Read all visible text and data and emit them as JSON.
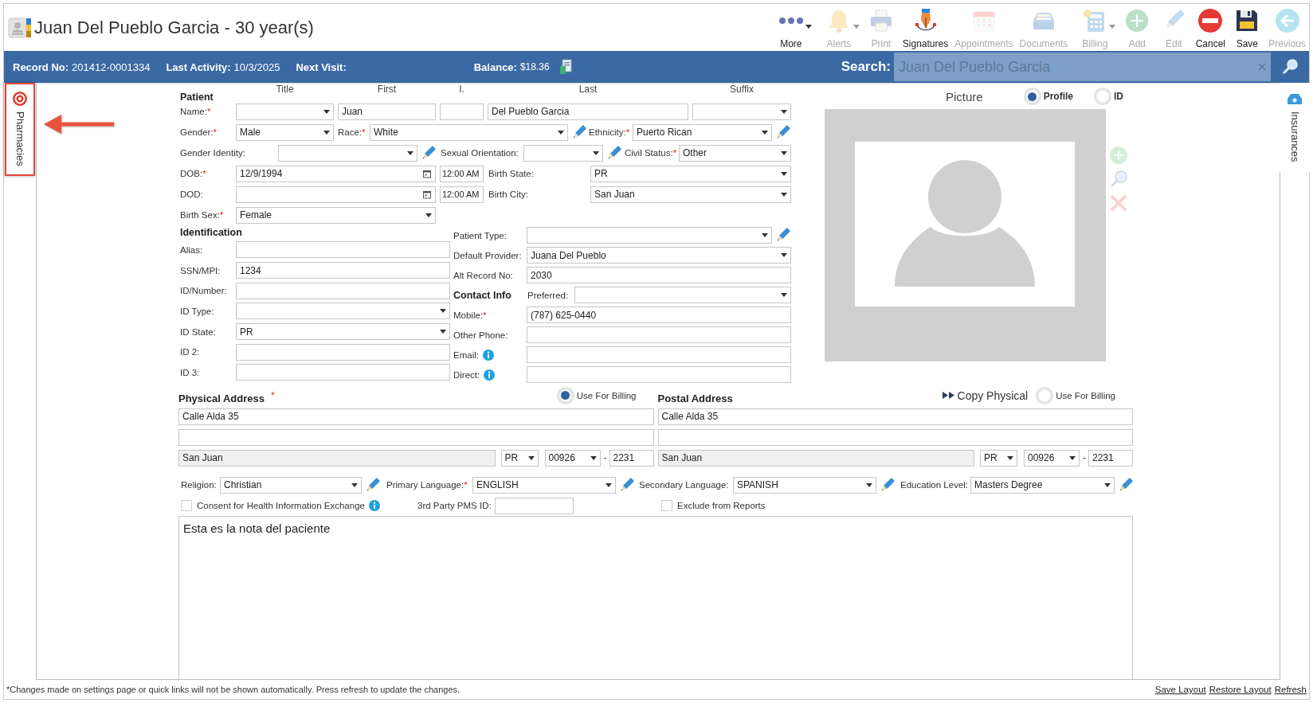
{
  "title": "Juan Del Pueblo Garcia - 30 year(s)",
  "toolbar": [
    {
      "label": "More",
      "disabled": false,
      "dropdown": true
    },
    {
      "label": "Alerts",
      "disabled": true,
      "dropdown": true
    },
    {
      "label": "Print",
      "disabled": true,
      "dropdown": false
    },
    {
      "label": "Signatures",
      "disabled": false,
      "dropdown": false
    },
    {
      "label": "Appointments",
      "disabled": true,
      "dropdown": false
    },
    {
      "label": "Documents",
      "disabled": true,
      "dropdown": false
    },
    {
      "label": "Billing",
      "disabled": true,
      "dropdown": true
    },
    {
      "label": "Add",
      "disabled": true,
      "dropdown": false
    },
    {
      "label": "Edit",
      "disabled": true,
      "dropdown": false
    },
    {
      "label": "Cancel",
      "disabled": false,
      "dropdown": false
    },
    {
      "label": "Save",
      "disabled": false,
      "dropdown": false
    },
    {
      "label": "Previous",
      "disabled": true,
      "dropdown": false
    }
  ],
  "info_bar": {
    "items": [
      {
        "label": "Record No:",
        "value": "201412-0001334"
      },
      {
        "label": "Last Activity:",
        "value": "10/3/2025"
      },
      {
        "label": "Next Visit:"
      }
    ],
    "balance": {
      "label": "Balance:",
      "value": "$18.36"
    }
  },
  "search": {
    "label": "Search:",
    "value": "Juan Del Pueblo Garcia"
  },
  "left_tabs": [
    {
      "label": "Pharmacies",
      "highlighted": true
    }
  ],
  "right_tabs": [
    {
      "label": "Insurances",
      "highlighted": false
    }
  ],
  "patient_rows": [
    [
      {
        "kind": "heading",
        "text": "Patient"
      },
      {
        "kind": "caption",
        "text": "Title"
      },
      {
        "kind": "caption",
        "text": "First"
      },
      {
        "kind": "caption",
        "text": "I."
      },
      {
        "kind": "caption",
        "text": "Last"
      },
      {
        "kind": "caption",
        "text": "Suffix"
      }
    ],
    [
      {
        "kind": "label",
        "text": "Name:",
        "mark": "*"
      },
      {
        "kind": "select"
      },
      {
        "kind": "text",
        "value": "Juan"
      },
      {
        "kind": "text"
      },
      {
        "kind": "text",
        "value": "Del Pueblo Garcia"
      },
      {
        "kind": "select"
      }
    ],
    [
      {
        "kind": "label",
        "text": "Gender:",
        "mark": "*"
      },
      {
        "kind": "select",
        "value": "Male"
      },
      {
        "kind": "label",
        "text": "Race:",
        "mark": "*"
      },
      {
        "kind": "select",
        "value": "White",
        "edit_button": true
      },
      {
        "kind": "label",
        "text": "Ethnicity:",
        "mark": "*"
      },
      {
        "kind": "select",
        "value": "Puerto Rican",
        "edit_button": true
      }
    ],
    [
      {
        "kind": "label",
        "text": "Gender Identity:"
      },
      {
        "kind": "select",
        "edit_button": true
      },
      {
        "kind": "label",
        "text": "Sexual Orientation:"
      },
      {
        "kind": "select",
        "edit_button": true
      },
      {
        "kind": "label",
        "text": "Civil Status:",
        "mark": "*"
      },
      {
        "kind": "select",
        "value": "Other"
      }
    ],
    [
      {
        "kind": "label",
        "text": "DOB:",
        "mark": "*"
      },
      {
        "kind": "date",
        "value": "12/9/1994"
      },
      {
        "kind": "time",
        "value": "12:00 AM"
      },
      {
        "kind": "label",
        "text": "Birth State:"
      },
      {
        "kind": "select",
        "value": "PR"
      }
    ],
    [
      {
        "kind": "label",
        "text": "DOD:"
      },
      {
        "kind": "date"
      },
      {
        "kind": "time",
        "value": "12:00 AM"
      },
      {
        "kind": "label",
        "text": "Birth City:"
      },
      {
        "kind": "select",
        "value": "San Juan"
      }
    ],
    [
      {
        "kind": "label",
        "text": "Birth Sex:",
        "mark": "*"
      },
      {
        "kind": "select",
        "value": "Female"
      }
    ]
  ],
  "identification": {
    "title": "Identification",
    "rows": [
      [
        {
          "kind": "label",
          "text": "Alias:"
        },
        {
          "kind": "text"
        }
      ],
      [
        {
          "kind": "label",
          "text": "SSN/MPI:"
        },
        {
          "kind": "text",
          "value": "1234"
        }
      ],
      [
        {
          "kind": "label",
          "text": "ID/Number:"
        },
        {
          "kind": "text"
        }
      ],
      [
        {
          "kind": "label",
          "text": "ID Type:"
        },
        {
          "kind": "select"
        }
      ],
      [
        {
          "kind": "label",
          "text": "ID State:"
        },
        {
          "kind": "select",
          "value": "PR"
        }
      ],
      [
        {
          "kind": "label",
          "text": "ID 2:"
        },
        {
          "kind": "text"
        }
      ],
      [
        {
          "kind": "label",
          "text": "ID 3:"
        },
        {
          "kind": "text"
        }
      ]
    ]
  },
  "contact_rows": [
    [
      {
        "kind": "label",
        "text": "Patient Type:"
      },
      {
        "kind": "select",
        "edit_button": true
      }
    ],
    [
      {
        "kind": "label",
        "text": "Default Provider:"
      },
      {
        "kind": "select",
        "value": "Juana Del Pueblo"
      }
    ],
    [
      {
        "kind": "label",
        "text": "Alt Record No:"
      },
      {
        "kind": "text",
        "value": "2030"
      }
    ],
    [
      {
        "kind": "heading",
        "text": "Contact Info"
      },
      {
        "kind": "label",
        "text": "Preferred:"
      },
      {
        "kind": "select"
      }
    ],
    [
      {
        "kind": "label",
        "text": "Mobile:",
        "mark": "*"
      },
      {
        "kind": "text",
        "value": "(787) 625-0440"
      }
    ],
    [
      {
        "kind": "label",
        "text": "Other Phone:"
      },
      {
        "kind": "text"
      }
    ],
    [
      {
        "kind": "label",
        "text": "Email:",
        "info": true
      },
      {
        "kind": "text"
      }
    ],
    [
      {
        "kind": "label",
        "text": "Direct:",
        "info": true
      },
      {
        "kind": "text"
      }
    ]
  ],
  "picture": {
    "title": "Picture",
    "modes": [
      {
        "label": "Profile",
        "selected": true
      },
      {
        "label": "ID",
        "selected": false
      }
    ]
  },
  "physical_address": {
    "title": "Physical Address",
    "mark": "*",
    "use_for_billing": {
      "label": "Use For Billing",
      "selected": true
    },
    "lines": [
      {
        "kind": "text",
        "value": "Calle Alda 35"
      },
      {
        "kind": "text"
      }
    ],
    "city": {
      "value": "San Juan",
      "readonly": true
    },
    "state": "PR",
    "zip": "00926",
    "zip_separator": "-",
    "zip_ext": "2231"
  },
  "postal_address": {
    "title": "Postal Address",
    "copy_button": "Copy Physical",
    "use_for_billing": {
      "label": "Use For Billing",
      "selected": false
    },
    "lines": [
      {
        "kind": "text",
        "value": "Calle Alda 35"
      },
      {
        "kind": "text"
      }
    ],
    "city": {
      "value": "San Juan",
      "readonly": true
    },
    "state": "PR",
    "zip": "00926",
    "zip_separator": "-",
    "zip_ext": "2231"
  },
  "demographics": [
    {
      "kind": "label",
      "text": "Religion:"
    },
    {
      "kind": "select",
      "value": "Christian",
      "edit_button": true
    },
    {
      "kind": "label",
      "text": "Primary Language:",
      "mark": "*"
    },
    {
      "kind": "select",
      "value": "ENGLISH",
      "edit_button": true
    },
    {
      "kind": "label",
      "text": "Secondary Language:"
    },
    {
      "kind": "select",
      "value": "SPANISH",
      "edit_button": true
    },
    {
      "kind": "label",
      "text": "Education Level:"
    },
    {
      "kind": "select",
      "value": "Masters Degree",
      "edit_button": true
    }
  ],
  "flags": [
    {
      "kind": "checkbox",
      "label": "Consent for Health Information Exchange",
      "checked": false,
      "info": true
    },
    {
      "kind": "label",
      "text": "3rd Party PMS ID:"
    },
    {
      "kind": "text"
    },
    {
      "kind": "checkbox",
      "label": "Exclude from Reports",
      "checked": false
    }
  ],
  "notes": "Esta es la nota del paciente",
  "footer": {
    "message": "*Changes made on settings page or quick links will not be shown automatically. Press refresh to update the changes.",
    "links": [
      "Save Layout",
      "Restore Layout",
      "Refresh"
    ]
  }
}
